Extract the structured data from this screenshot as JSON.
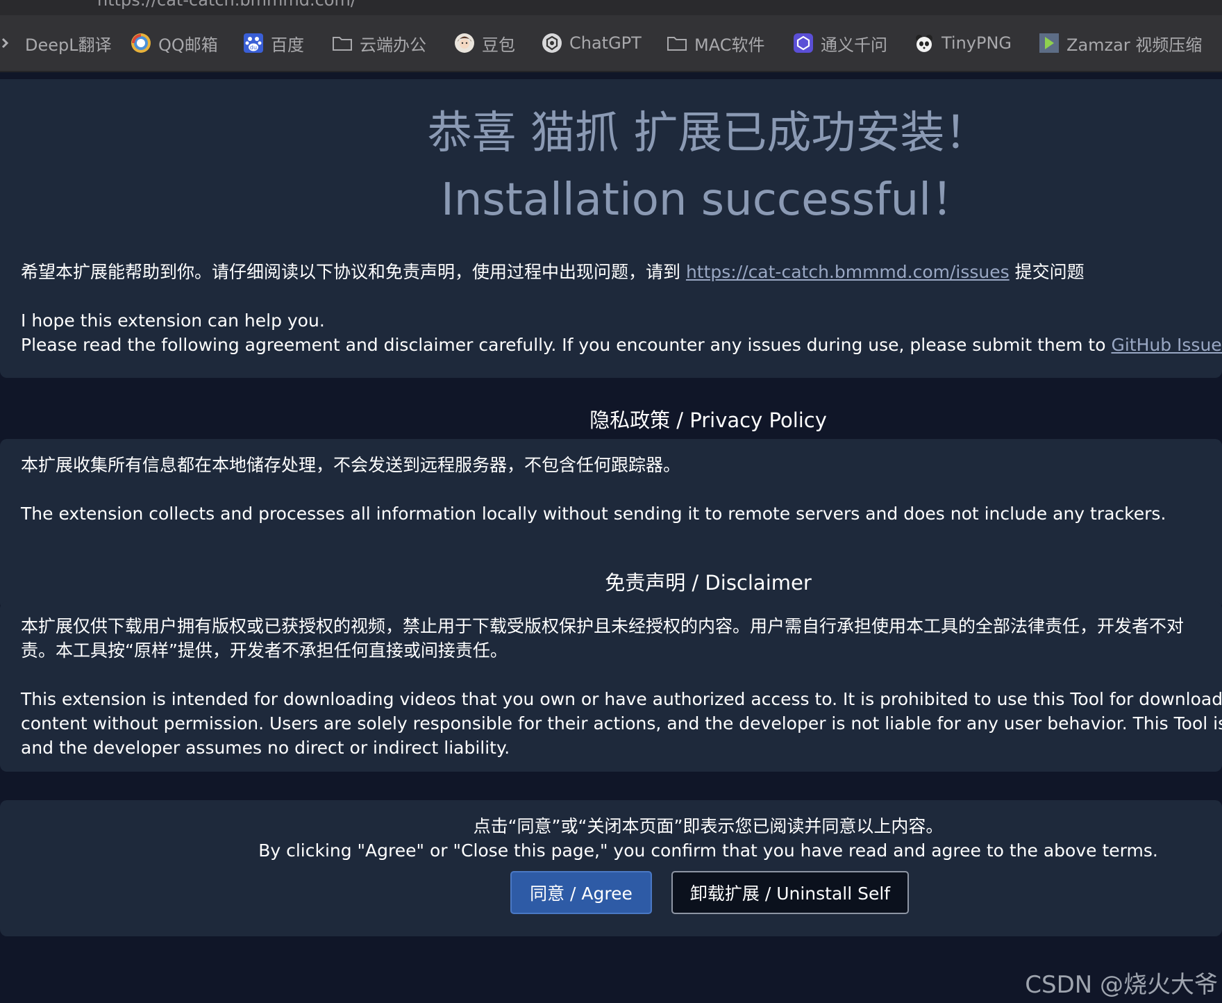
{
  "url_bar": {
    "partial_text": "https://cat-catch.bmmmd.com/"
  },
  "bookmarks": [
    {
      "label": "DeepL翻译",
      "icon": "deepl-icon"
    },
    {
      "label": "QQ邮箱",
      "icon": "qq-mail-icon"
    },
    {
      "label": "百度",
      "icon": "baidu-paw-icon"
    },
    {
      "label": "云端办公",
      "icon": "folder-icon"
    },
    {
      "label": "豆包",
      "icon": "doubao-avatar-icon"
    },
    {
      "label": "ChatGPT",
      "icon": "chatgpt-icon"
    },
    {
      "label": "MAC软件",
      "icon": "folder-icon"
    },
    {
      "label": "通义千问",
      "icon": "tongyi-icon"
    },
    {
      "label": "TinyPNG",
      "icon": "panda-icon"
    },
    {
      "label": "Zamzar 视频压缩",
      "icon": "zamzar-icon"
    }
  ],
  "hero": {
    "title_cn": "恭喜 猫抓 扩展已成功安装！",
    "title_en": "Installation successful！",
    "intro_cn_before": "希望本扩展能帮助到你。请仔细阅读以下协议和免责声明，使用过程中出现问题，请到 ",
    "intro_cn_link": "https://cat-catch.bmmmd.com/issues",
    "intro_cn_after": " 提交问题",
    "intro_en_line1": "I hope this extension can help you.",
    "intro_en_line2_before": "Please read the following agreement and disclaimer carefully. If you encounter any issues during use, please submit them to ",
    "intro_en_link": "GitHub Issues"
  },
  "privacy": {
    "heading": "隐私政策 / Privacy Policy",
    "text_cn": "本扩展收集所有信息都在本地储存处理，不会发送到远程服务器，不包含任何跟踪器。",
    "text_en": "The extension collects and processes all information locally without sending it to remote servers and does not include any trackers."
  },
  "disclaimer": {
    "heading": "免责声明 / Disclaimer",
    "text_cn_line1": "本扩展仅供下载用户拥有版权或已获授权的视频，禁止用于下载受版权保护且未经授权的内容。用户需自行承担使用本工具的全部法律责任，开发者不对",
    "text_cn_line2": "责。本工具按“原样”提供，开发者不承担任何直接或间接责任。",
    "text_en_line1": "This extension is intended for downloading videos that you own or have authorized access to. It is prohibited to use this Tool for downloadi",
    "text_en_line2": "content without permission. Users are solely responsible for their actions, and the developer is not liable for any user behavior. This Tool is p",
    "text_en_line3": "and the developer assumes no direct or indirect liability."
  },
  "confirm": {
    "text_cn": "点击“同意”或“关闭本页面”即表示您已阅读并同意以上内容。",
    "text_en": "By clicking \"Agree\" or \"Close this page,\" you confirm that you have read and agree to the above terms.",
    "agree_label": "同意 / Agree",
    "uninstall_label": "卸载扩展 / Uninstall Self"
  },
  "watermark": "CSDN @烧火大爷",
  "colors": {
    "page_bg": "#101628",
    "panel_bg": "#1e293b",
    "title_color": "#8b9ab4",
    "link_color": "#9aa8c4",
    "agree_button": "#2e5ba6",
    "uninstall_button": "#0b111d"
  }
}
